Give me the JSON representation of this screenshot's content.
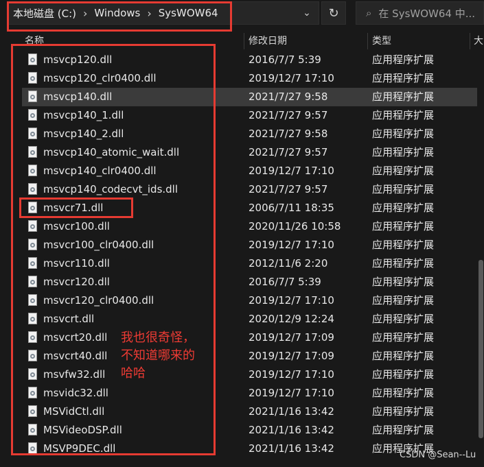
{
  "address": {
    "crumbs": [
      "本地磁盘 (C:)",
      "Windows",
      "SysWOW64"
    ]
  },
  "search": {
    "placeholder": "在 SysWOW64 中..."
  },
  "columns": {
    "name": "名称",
    "date": "修改日期",
    "type": "类型",
    "size": "大"
  },
  "files": [
    {
      "name": "msvcp120.dll",
      "date": "2016/7/7 5:39",
      "type": "应用程序扩展"
    },
    {
      "name": "msvcp120_clr0400.dll",
      "date": "2019/12/7 17:10",
      "type": "应用程序扩展"
    },
    {
      "name": "msvcp140.dll",
      "date": "2021/7/27 9:58",
      "type": "应用程序扩展",
      "selected": true
    },
    {
      "name": "msvcp140_1.dll",
      "date": "2021/7/27 9:57",
      "type": "应用程序扩展"
    },
    {
      "name": "msvcp140_2.dll",
      "date": "2021/7/27 9:58",
      "type": "应用程序扩展"
    },
    {
      "name": "msvcp140_atomic_wait.dll",
      "date": "2021/7/27 9:57",
      "type": "应用程序扩展"
    },
    {
      "name": "msvcp140_clr0400.dll",
      "date": "2019/12/7 17:10",
      "type": "应用程序扩展"
    },
    {
      "name": "msvcp140_codecvt_ids.dll",
      "date": "2021/7/27 9:57",
      "type": "应用程序扩展"
    },
    {
      "name": "msvcr71.dll",
      "date": "2006/7/11 18:35",
      "type": "应用程序扩展",
      "highlighted": true
    },
    {
      "name": "msvcr100.dll",
      "date": "2020/11/26 10:58",
      "type": "应用程序扩展"
    },
    {
      "name": "msvcr100_clr0400.dll",
      "date": "2019/12/7 17:10",
      "type": "应用程序扩展"
    },
    {
      "name": "msvcr110.dll",
      "date": "2012/11/6 2:20",
      "type": "应用程序扩展"
    },
    {
      "name": "msvcr120.dll",
      "date": "2016/7/7 5:39",
      "type": "应用程序扩展"
    },
    {
      "name": "msvcr120_clr0400.dll",
      "date": "2019/12/7 17:10",
      "type": "应用程序扩展"
    },
    {
      "name": "msvcrt.dll",
      "date": "2020/12/9 12:24",
      "type": "应用程序扩展"
    },
    {
      "name": "msvcrt20.dll",
      "date": "2019/12/7 17:09",
      "type": "应用程序扩展"
    },
    {
      "name": "msvcrt40.dll",
      "date": "2019/12/7 17:09",
      "type": "应用程序扩展"
    },
    {
      "name": "msvfw32.dll",
      "date": "2019/12/7 17:10",
      "type": "应用程序扩展"
    },
    {
      "name": "msvidc32.dll",
      "date": "2019/12/7 17:10",
      "type": "应用程序扩展"
    },
    {
      "name": "MSVidCtl.dll",
      "date": "2021/1/16 13:42",
      "type": "应用程序扩展"
    },
    {
      "name": "MSVideoDSP.dll",
      "date": "2021/1/16 13:42",
      "type": "应用程序扩展"
    },
    {
      "name": "MSVP9DEC.dll",
      "date": "2021/1/16 13:42",
      "type": "应用程序扩展"
    }
  ],
  "annotation": {
    "note": "我也很奇怪，\n不知道哪来的\n哈哈"
  },
  "watermark": "CSDN @Sean--Lu",
  "colors": {
    "annotation_red": "#e63b32",
    "background": "#191919",
    "selected_row": "#3b3b3b"
  }
}
